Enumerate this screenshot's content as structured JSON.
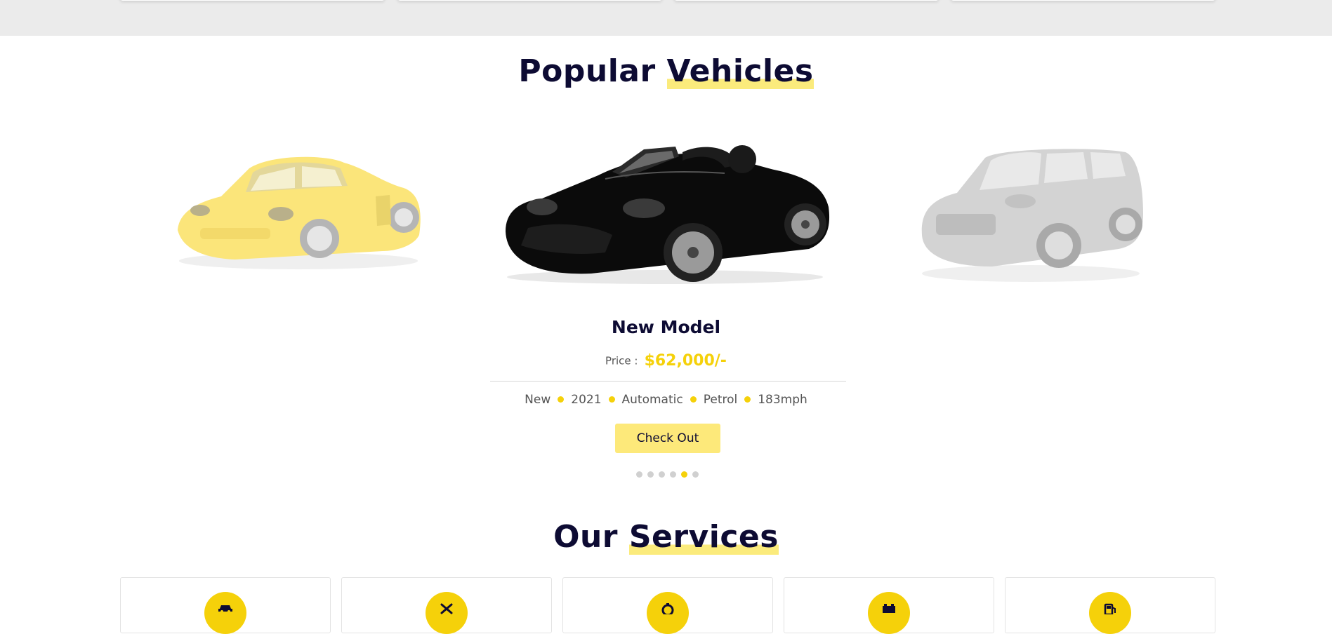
{
  "sections": {
    "popular_title": "Popular",
    "popular_highlight": "Vehicles",
    "services_title": "Our",
    "services_highlight": "Services"
  },
  "carousel": {
    "cars": [
      {
        "name": "yellow-coupe",
        "color": "#fbe57a"
      },
      {
        "name": "black-convertible",
        "color": "#0a0a0a"
      },
      {
        "name": "silver-suv",
        "color": "#d6d6d6"
      }
    ],
    "active": {
      "model": "New Model",
      "price_label": "Price :",
      "price": "$62,000/-",
      "specs": [
        "New",
        "2021",
        "Automatic",
        "Petrol",
        "183mph"
      ],
      "button": "Check Out"
    },
    "pages": 6,
    "active_page": 5
  },
  "services": [
    {
      "icon": "car-icon"
    },
    {
      "icon": "wrench-icon"
    },
    {
      "icon": "gear-icon"
    },
    {
      "icon": "battery-icon"
    },
    {
      "icon": "fuel-icon"
    }
  ],
  "colors": {
    "accent": "#f5d10a",
    "accent_light": "#fde97a",
    "navy": "#0d0b33"
  }
}
